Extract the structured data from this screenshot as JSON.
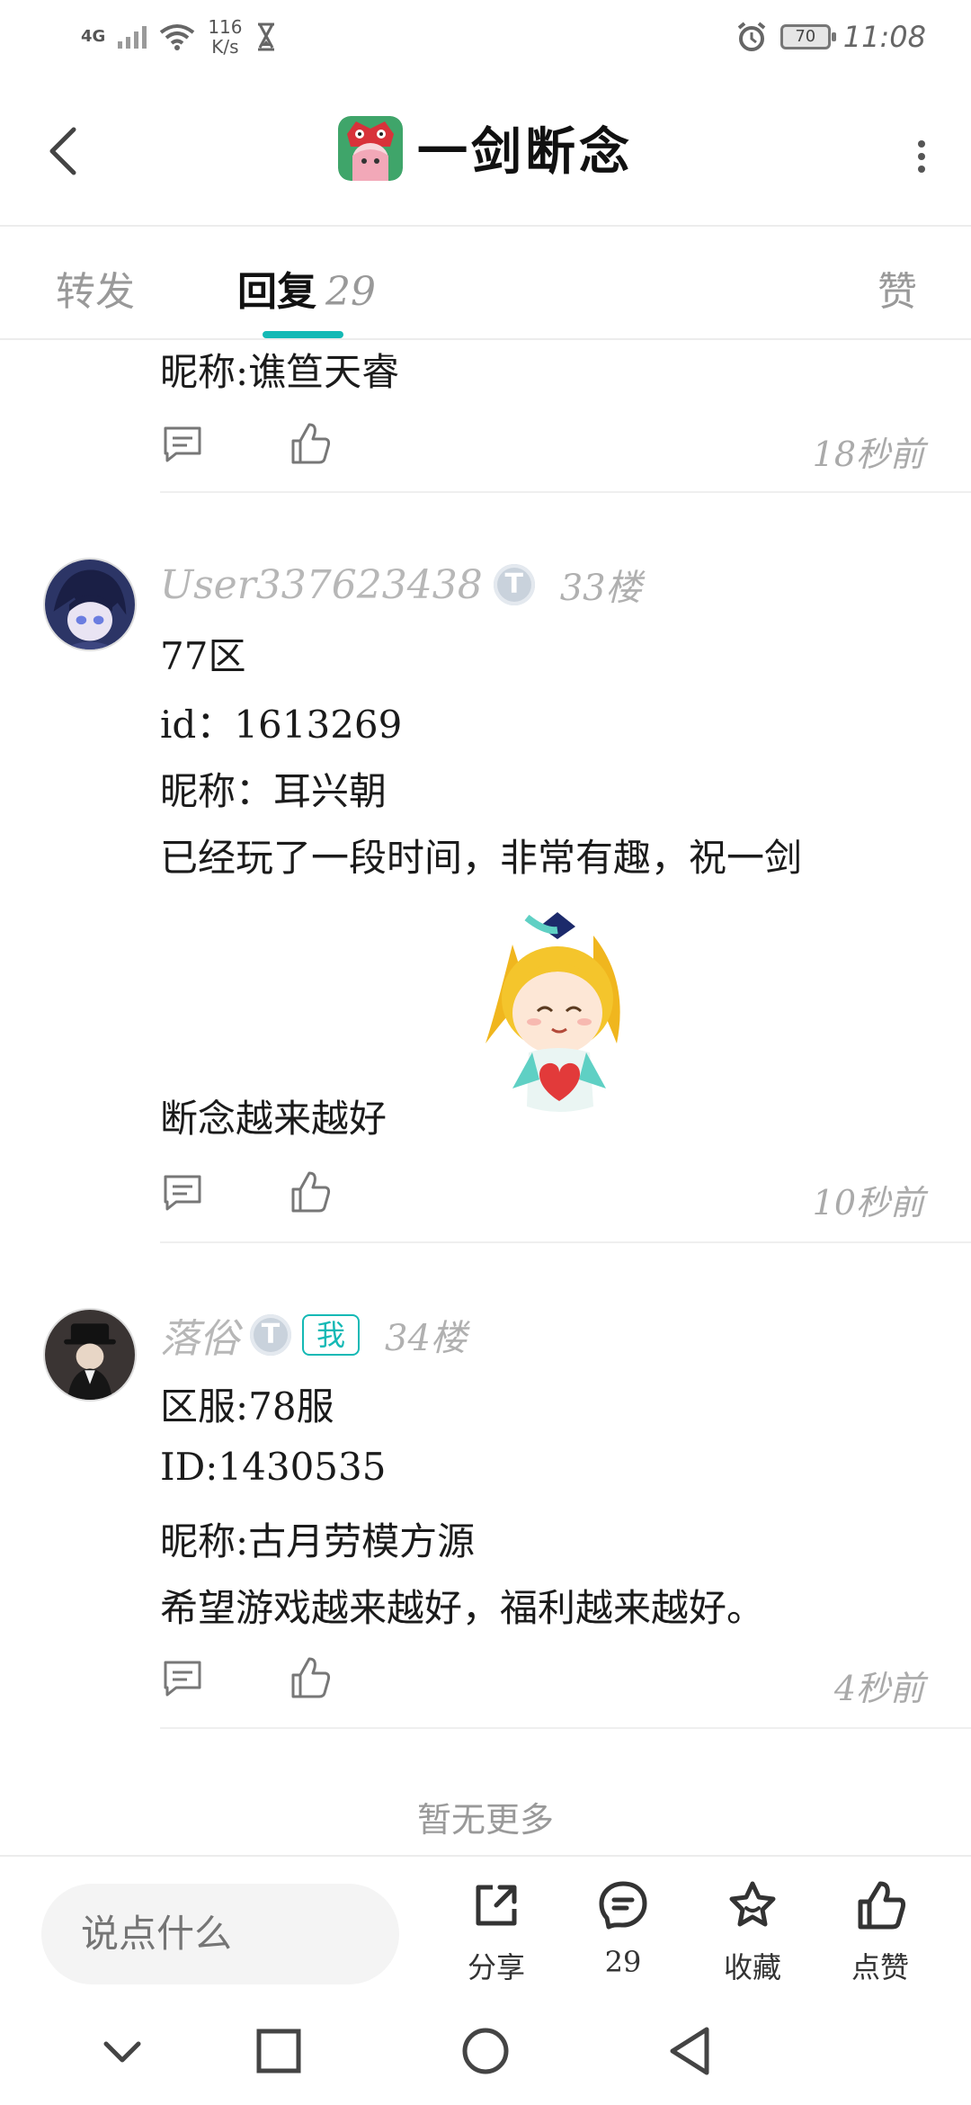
{
  "status_bar": {
    "signal_label": "4G",
    "network_speed": "116",
    "network_speed_unit": "K/s",
    "battery_level": "70",
    "time": "11:08"
  },
  "header": {
    "title": "一剑断念",
    "back_icon": "chevron-left-icon",
    "more_icon": "more-vertical-icon"
  },
  "tabs": {
    "repost": "转发",
    "reply": "回复",
    "reply_count": "29",
    "like": "赞"
  },
  "comments": [
    {
      "lines": [
        "昵称:谯笪天睿"
      ],
      "time": "18秒前"
    },
    {
      "author": "User337623438",
      "level": "T",
      "floor": "33楼",
      "lines": [
        "77区",
        "id：1613269",
        "昵称：耳兴朝",
        "已经玩了一段时间，非常有趣，祝一剑",
        "断念越来越好"
      ],
      "time": "10秒前"
    },
    {
      "author": "落俗",
      "level": "T",
      "me_tag": "我",
      "floor": "34楼",
      "lines": [
        "区服:78服",
        "ID:1430535",
        "昵称:古月劳模方源",
        "希望游戏越来越好，福利越来越好。"
      ],
      "time": "4秒前"
    }
  ],
  "footer": {
    "no_more": "暂无更多"
  },
  "bottom_bar": {
    "input_placeholder": "说点什么",
    "share_label": "分享",
    "comment_count": "29",
    "favorite_label": "收藏",
    "like_label": "点赞"
  },
  "colors": {
    "accent": "#14b9b5",
    "text_muted": "#aaaaaa"
  }
}
